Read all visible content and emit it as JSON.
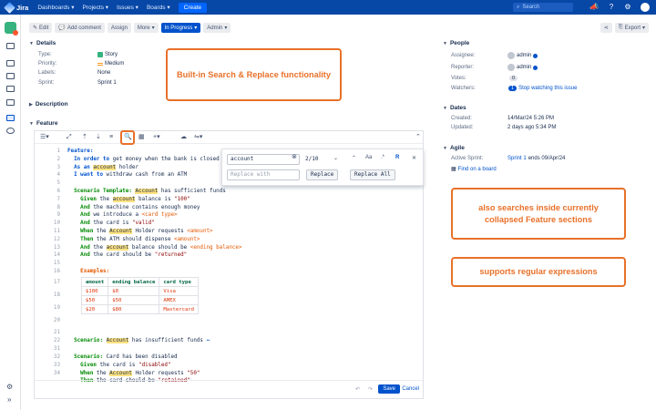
{
  "nav": {
    "brand": "Jira",
    "menus": [
      "Dashboards",
      "Projects",
      "Issues",
      "Boards"
    ],
    "create": "Create",
    "search_placeholder": "Search"
  },
  "toolbar": {
    "edit": "Edit",
    "add_comment": "Add comment",
    "assign": "Assign",
    "more": "More",
    "status": "In Progress",
    "admin": "Admin",
    "export": "Export"
  },
  "details": {
    "heading": "Details",
    "type_label": "Type:",
    "type_value": "Story",
    "priority_label": "Priority:",
    "priority_value": "Medium",
    "labels_label": "Labels:",
    "labels_value": "None",
    "sprint_label": "Sprint:",
    "sprint_value": "Sprint 1"
  },
  "description_heading": "Description",
  "feature_heading": "Feature",
  "search_replace": {
    "query": "account",
    "count": "2/10",
    "replace_placeholder": "Replace with",
    "replace": "Replace",
    "replace_all": "Replace All",
    "case_label": "Aa",
    "word_label": ".*",
    "regex_label": "R"
  },
  "code": {
    "line_numbers": [
      "1",
      "2",
      "3",
      "4",
      "5",
      "6",
      "7",
      "8",
      "9",
      "10",
      "11",
      "12",
      "13",
      "14",
      "15",
      "16",
      "17",
      "18",
      "19",
      "20",
      "21",
      "22",
      "31",
      "32",
      "33",
      "34"
    ]
  },
  "examples_table": {
    "headers": [
      "amount",
      "ending balance",
      "card type"
    ],
    "rows": [
      [
        "$100",
        "$0",
        "Visa"
      ],
      [
        "$50",
        "$50",
        "AMEX"
      ],
      [
        "$20",
        "$80",
        "Mastercard"
      ]
    ]
  },
  "editor_footer": {
    "save": "Save",
    "cancel": "Cancel"
  },
  "people": {
    "heading": "People",
    "assignee_label": "Assignee:",
    "assignee": "admin",
    "reporter_label": "Reporter:",
    "reporter": "admin",
    "votes_label": "Votes:",
    "votes": "0",
    "watchers_label": "Watchers:",
    "watchers": "1",
    "watch_link": "Stop watching this issue"
  },
  "dates": {
    "heading": "Dates",
    "created_label": "Created:",
    "created": "14/Mar/24 5:26 PM",
    "updated_label": "Updated:",
    "updated": "2 days ago 5:34 PM"
  },
  "agile": {
    "heading": "Agile",
    "active_sprint_label": "Active Sprint:",
    "sprint_link": "Sprint 1",
    "sprint_end": "ends 09/Apr/24",
    "find_on_board": "Find on a board"
  },
  "callouts": {
    "c1": "Built-in Search & Replace functionality",
    "c2": "also searches inside currently collapsed Feature sections",
    "c3": "supports regular expressions"
  },
  "colors": {
    "accent": "#e8712a",
    "nav": "#0747a6",
    "primary": "#0052cc"
  }
}
